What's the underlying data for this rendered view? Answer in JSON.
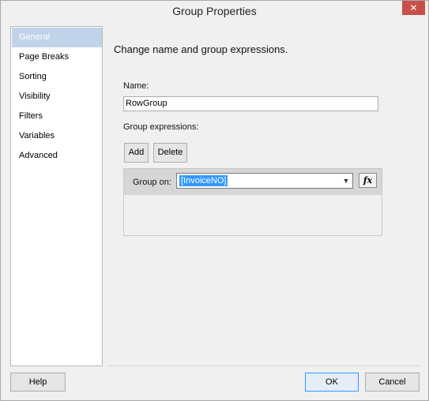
{
  "window": {
    "title": "Group Properties",
    "close_glyph": "✕"
  },
  "nav": {
    "items": [
      {
        "label": "General",
        "selected": true
      },
      {
        "label": "Page Breaks"
      },
      {
        "label": "Sorting"
      },
      {
        "label": "Visibility"
      },
      {
        "label": "Filters"
      },
      {
        "label": "Variables"
      },
      {
        "label": "Advanced"
      }
    ]
  },
  "general": {
    "heading": "Change name and group expressions.",
    "name_label": "Name:",
    "name_value": "RowGroup",
    "group_expr_label": "Group expressions:",
    "add_label": "Add",
    "delete_label": "Delete",
    "group_on_label": "Group on:",
    "group_on_value": "[InvoiceNO]",
    "fx_label": "fx",
    "dropdown_icon": "chevron-down-icon"
  },
  "footer": {
    "help_label": "Help",
    "ok_label": "OK",
    "cancel_label": "Cancel"
  },
  "colors": {
    "selected_nav_bg": "#c1d3e8",
    "close_bg": "#c7504b",
    "selection_blue": "#3399ff"
  }
}
